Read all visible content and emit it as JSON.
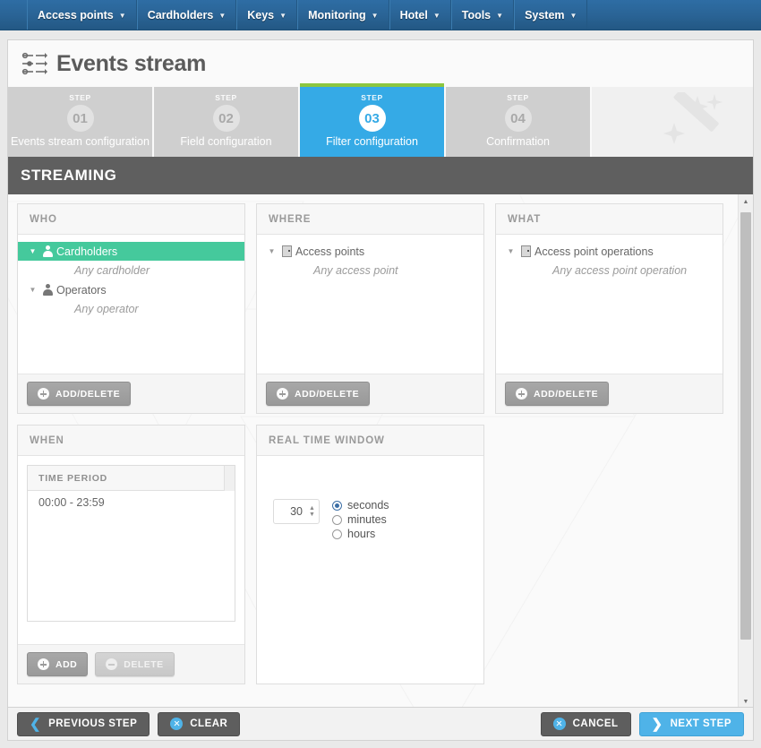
{
  "nav": {
    "items": [
      {
        "label": "Access points",
        "caret": "caret-down-icon"
      },
      {
        "label": "Cardholders",
        "caret": "caret-down-icon"
      },
      {
        "label": "Keys",
        "caret": "caret-down-icon"
      },
      {
        "label": "Monitoring",
        "caret": "caret-down-icon"
      },
      {
        "label": "Hotel",
        "caret": "caret-down-icon"
      },
      {
        "label": "Tools",
        "caret": "caret-down-icon"
      },
      {
        "label": "System",
        "caret": "caret-down-icon"
      }
    ]
  },
  "header": {
    "title": "Events stream",
    "icon": "events-stream-icon"
  },
  "wizard": {
    "step_label": "STEP",
    "wand_icon": "magic-wand-icon",
    "steps": [
      {
        "num": "01",
        "name": "Events stream configuration",
        "active": false
      },
      {
        "num": "02",
        "name": "Field configuration",
        "active": false
      },
      {
        "num": "03",
        "name": "Filter configuration",
        "active": true
      },
      {
        "num": "04",
        "name": "Confirmation",
        "active": false
      }
    ]
  },
  "section": {
    "title": "STREAMING"
  },
  "panels": {
    "who": {
      "title": "WHO",
      "add_delete_label": "ADD/DELETE",
      "tree": [
        {
          "label": "Cardholders",
          "icon": "person-icon",
          "selected": true,
          "sub": "Any cardholder"
        },
        {
          "label": "Operators",
          "icon": "person-icon",
          "selected": false,
          "sub": "Any operator"
        }
      ]
    },
    "where": {
      "title": "WHERE",
      "add_delete_label": "ADD/DELETE",
      "tree": [
        {
          "label": "Access points",
          "icon": "door-icon",
          "selected": false,
          "sub": "Any access point"
        }
      ]
    },
    "what": {
      "title": "WHAT",
      "add_delete_label": "ADD/DELETE",
      "tree": [
        {
          "label": "Access point operations",
          "icon": "door-icon",
          "selected": false,
          "sub": "Any access point operation"
        }
      ]
    },
    "when": {
      "title": "WHEN",
      "grid_header": "TIME PERIOD",
      "rows": [
        "00:00 - 23:59"
      ],
      "add_label": "ADD",
      "delete_label": "DELETE",
      "delete_disabled": true
    },
    "real_time_window": {
      "title": "REAL TIME WINDOW",
      "value": "30",
      "units": [
        {
          "label": "seconds",
          "checked": true
        },
        {
          "label": "minutes",
          "checked": false
        },
        {
          "label": "hours",
          "checked": false
        }
      ]
    }
  },
  "footer": {
    "previous_step": "PREVIOUS STEP",
    "clear": "CLEAR",
    "cancel": "CANCEL",
    "next_step": "NEXT STEP"
  },
  "colors": {
    "nav_blue": "#2a6496",
    "accent_blue": "#35aae6",
    "active_green": "#8cc63f",
    "selection_green": "#45c99c",
    "section_grey": "#5f5f5f"
  },
  "scrollbar": {
    "up_icon": "triangle-up-icon",
    "down_icon": "triangle-down-icon"
  }
}
